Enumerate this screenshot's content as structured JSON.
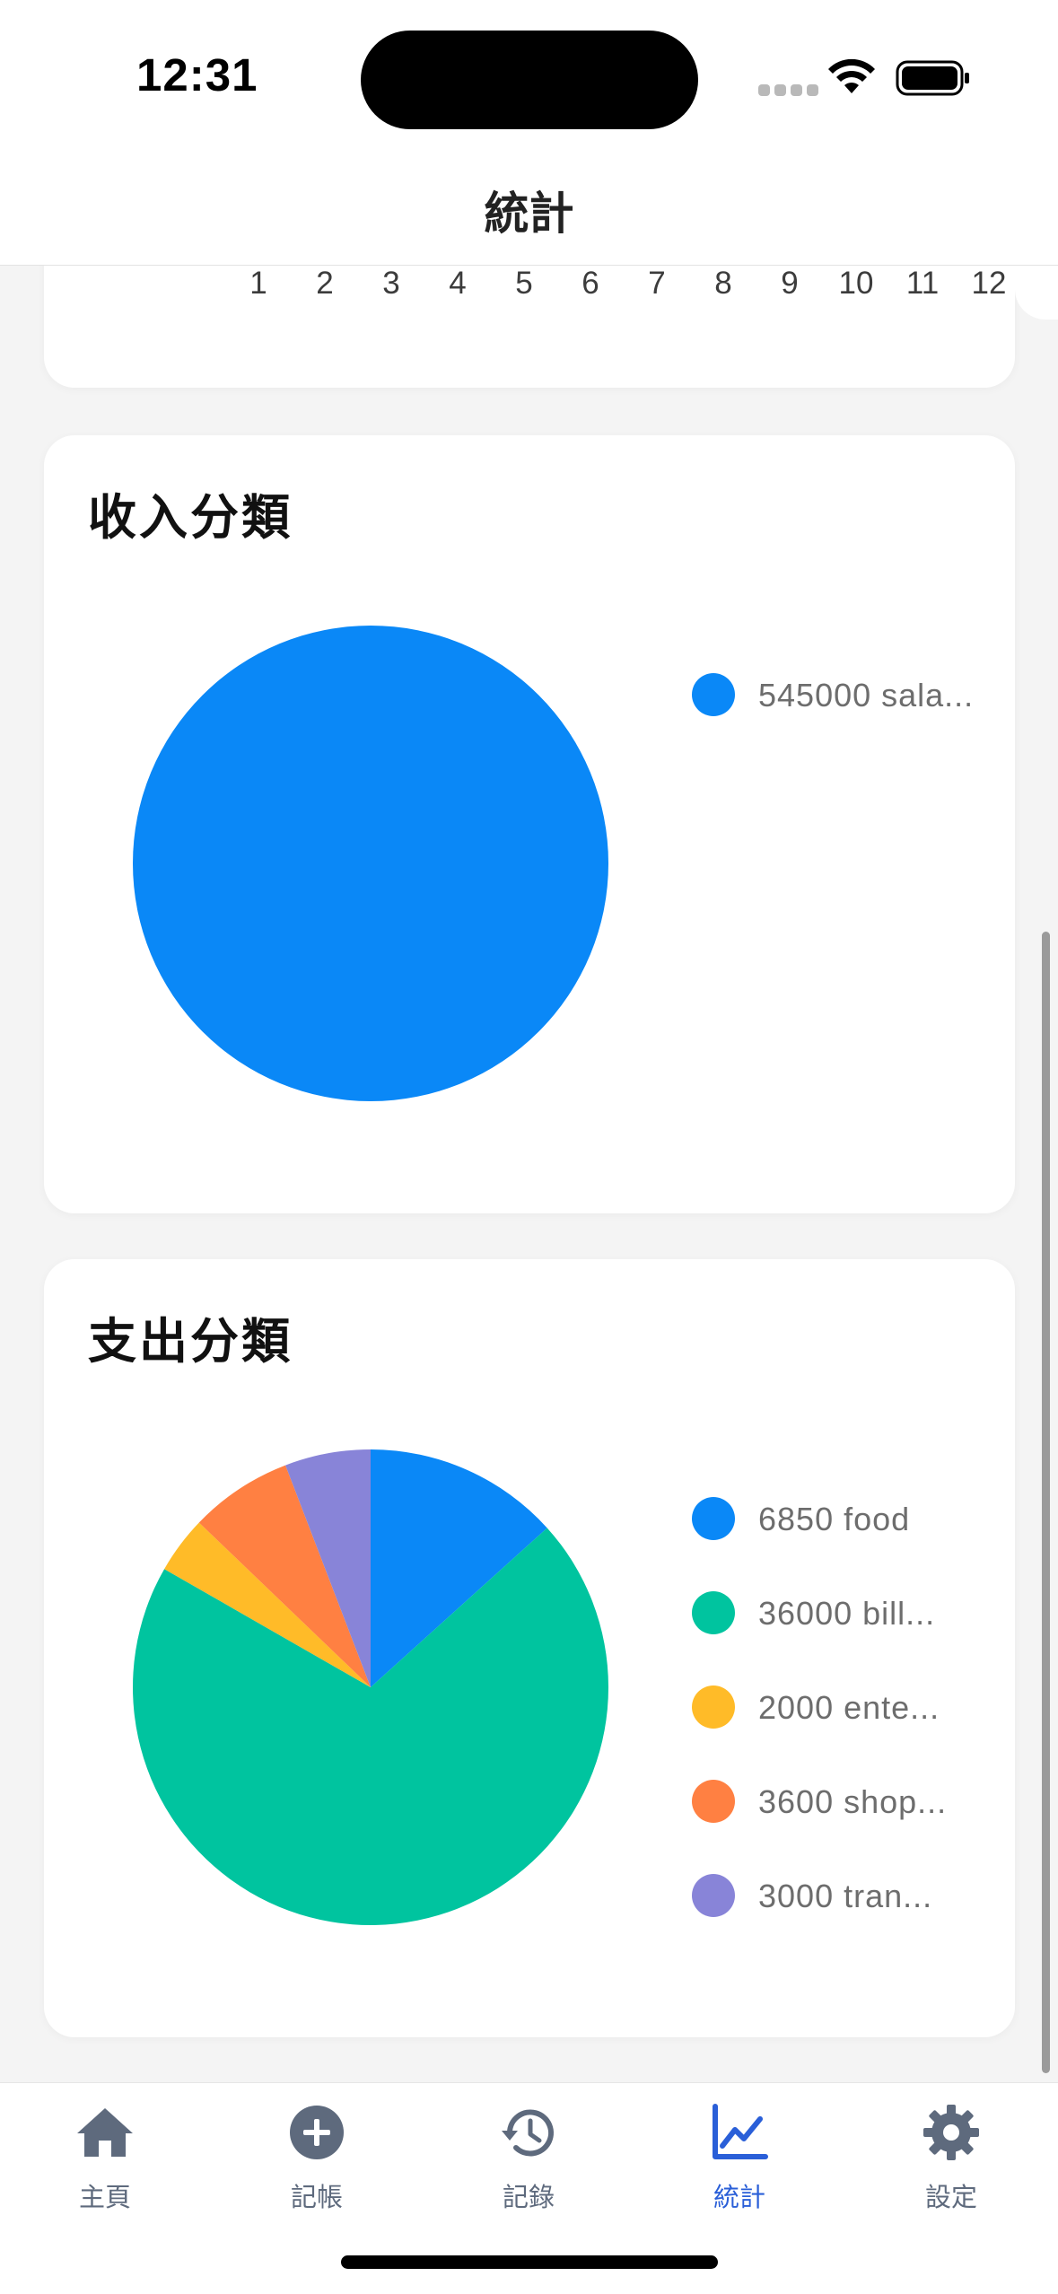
{
  "status_bar": {
    "time": "12:31"
  },
  "nav": {
    "title": "統計"
  },
  "monthly_chart": {
    "x_labels": [
      "1",
      "2",
      "3",
      "4",
      "5",
      "6",
      "7",
      "8",
      "9",
      "10",
      "11",
      "12"
    ]
  },
  "income_card": {
    "title": "收入分類",
    "legend": [
      {
        "label": "545000 sala...",
        "color": "#0a88f7"
      }
    ]
  },
  "expense_card": {
    "title": "支出分類",
    "legend": [
      {
        "label": "6850 food",
        "color": "#0a88f7"
      },
      {
        "label": "36000 bill...",
        "color": "#00c49f"
      },
      {
        "label": "2000 ente...",
        "color": "#ffbb28"
      },
      {
        "label": "3600 shop...",
        "color": "#ff8042"
      },
      {
        "label": "3000 tran...",
        "color": "#8884d8"
      }
    ]
  },
  "chart_data": [
    {
      "type": "pie",
      "categories": [
        "salary"
      ],
      "values": [
        545000
      ],
      "colors": [
        "#0a88f7"
      ]
    },
    {
      "type": "pie",
      "categories": [
        "food",
        "bills",
        "entertainment",
        "shopping",
        "transport"
      ],
      "values": [
        6850,
        36000,
        2000,
        3600,
        3000
      ],
      "colors": [
        "#0a88f7",
        "#00c49f",
        "#ffbb28",
        "#ff8042",
        "#8884d8"
      ]
    }
  ],
  "tabs": [
    {
      "label": "主頁",
      "icon": "home-icon",
      "active": false
    },
    {
      "label": "記帳",
      "icon": "add-circle-icon",
      "active": false
    },
    {
      "label": "記錄",
      "icon": "history-icon",
      "active": false
    },
    {
      "label": "統計",
      "icon": "chart-line-icon",
      "active": true
    },
    {
      "label": "設定",
      "icon": "gear-icon",
      "active": false
    }
  ],
  "colors": {
    "active_tab": "#2a5fd8",
    "inactive_tab": "#5e6a7d"
  }
}
